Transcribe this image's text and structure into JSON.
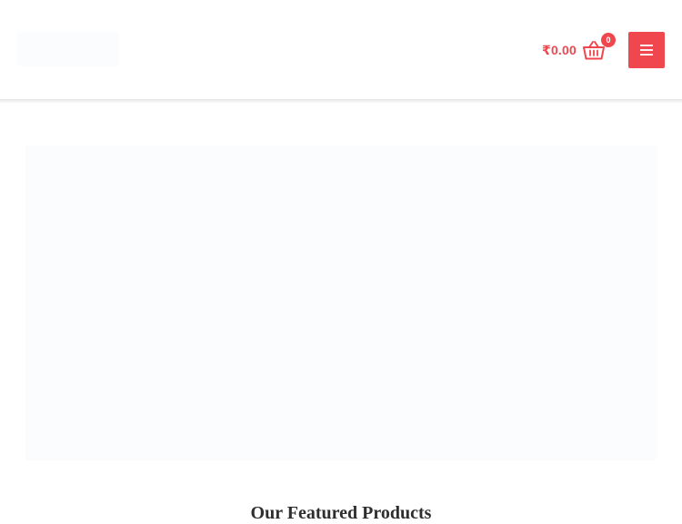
{
  "header": {
    "cart": {
      "total": "₹0.00",
      "count": "0",
      "icon": "basket-icon"
    },
    "menu_icon": "hamburger-menu-icon"
  },
  "main": {
    "section_heading": "Our Featured Products"
  },
  "colors": {
    "accent": "#f0474e",
    "background": "#ffffff",
    "placeholder": "#fbfcfd"
  }
}
